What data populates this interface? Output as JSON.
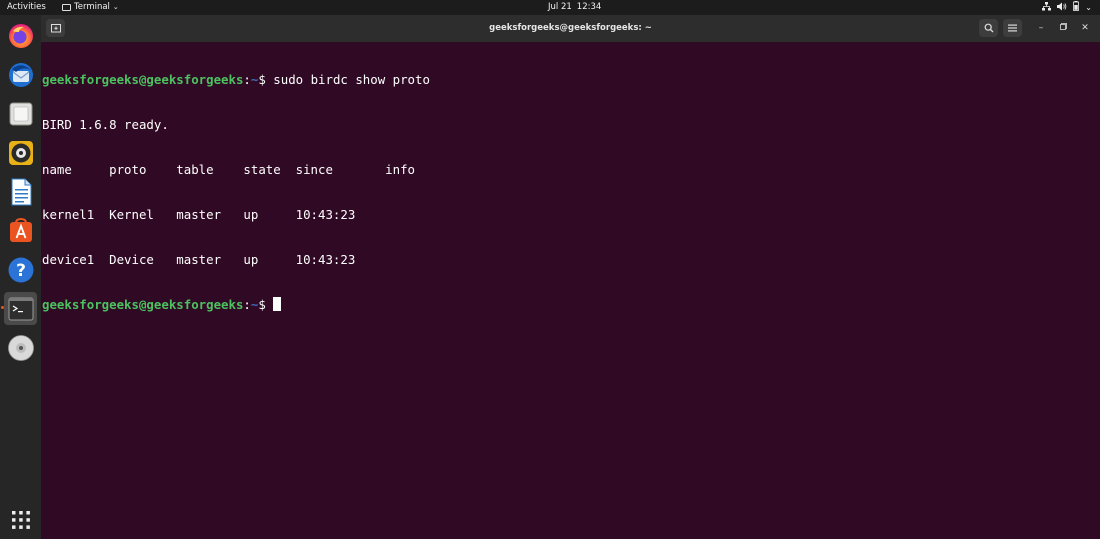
{
  "topbar": {
    "activities": "Activities",
    "app_name": "Terminal",
    "date": "Jul 21",
    "time": "12:34"
  },
  "dock": {
    "items": [
      {
        "name": "firefox-icon"
      },
      {
        "name": "thunderbird-icon"
      },
      {
        "name": "files-icon"
      },
      {
        "name": "rhythmbox-icon"
      },
      {
        "name": "libreoffice-writer-icon"
      },
      {
        "name": "ubuntu-software-icon"
      },
      {
        "name": "help-icon"
      },
      {
        "name": "terminal-icon"
      },
      {
        "name": "dvd-icon"
      },
      {
        "name": "show-apps-icon"
      }
    ]
  },
  "window": {
    "title": "geeksforgeeks@geeksforgeeks: ~"
  },
  "terminal": {
    "prompt_user": "geeksforgeeks@geeksforgeeks",
    "prompt_colon": ":",
    "prompt_path": "~",
    "prompt_symbol": "$ ",
    "command": "sudo birdc show proto",
    "output": [
      "BIRD 1.6.8 ready.",
      "name     proto    table    state  since       info",
      "kernel1  Kernel   master   up     10:43:23",
      "device1  Device   master   up     10:43:23"
    ]
  },
  "colors": {
    "terminal_bg": "#300a24",
    "prompt_user": "#4bc25f",
    "prompt_path": "#3f6bbd",
    "accent": "#e95420"
  }
}
